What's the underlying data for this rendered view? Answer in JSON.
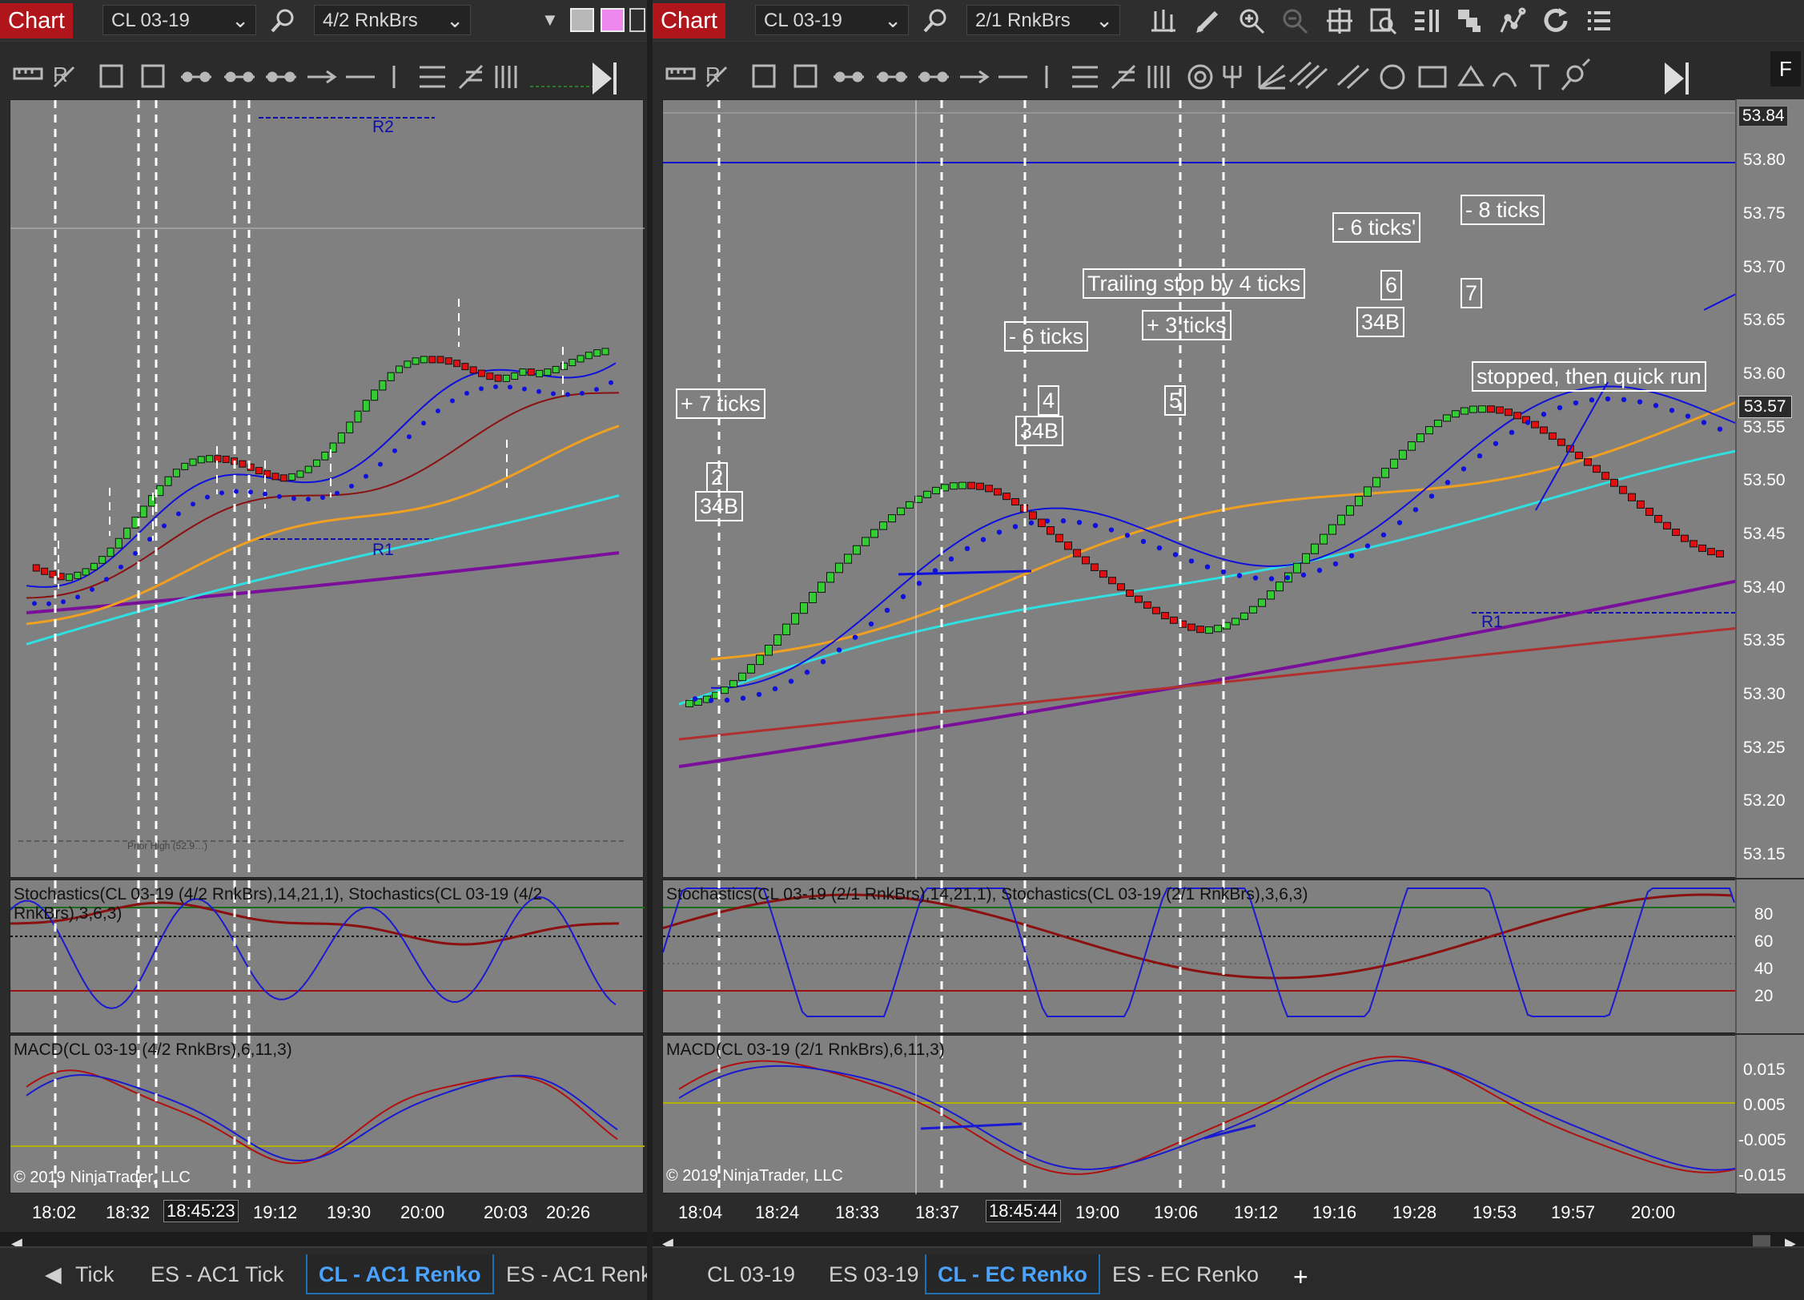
{
  "left": {
    "chart_tab": "Chart",
    "instrument": "CL 03-19",
    "period": "4/2 RnkBrs",
    "stochastics_label": "Stochastics(CL 03-19 (4/2 RnkBrs),14,21,1), Stochastics(CL 03-19 (4/2 RnkBrs),3,6,3)",
    "macd_label": "MACD(CL 03-19 (4/2 RnkBrs),6,11,3)",
    "copyright": "© 2019 NinjaTrader, LLC",
    "r2_label": "R2",
    "r1_label": "R1",
    "prior_high_label": "Prior High (52.9…)",
    "time_labels": [
      "18:02",
      "18:32",
      "18:45:23",
      "19:12",
      "19:30",
      "20:00",
      "20:03",
      "20:26"
    ],
    "tabs": [
      "Tick",
      "ES - AC1 Tick",
      "CL - AC1 Renko",
      "ES - AC1 Renk"
    ],
    "active_tab": "CL - AC1 Renko"
  },
  "right": {
    "chart_tab": "Chart",
    "instrument": "CL 03-19",
    "period": "2/1 RnkBrs",
    "stochastics_label": "Stochastics(CL 03-19 (2/1 RnkBrs),14,21,1), Stochastics(CL 03-19 (2/1 RnkBrs),3,6,3)",
    "macd_label": "MACD(CL 03-19 (2/1 RnkBrs),6,11,3)",
    "copyright": "© 2019 NinjaTrader, LLC",
    "r1_label": "R1",
    "f_button": "F",
    "price_labels": [
      "53.84",
      "53.80",
      "53.75",
      "53.70",
      "53.65",
      "53.60",
      "53.57",
      "53.55",
      "53.50",
      "53.45",
      "53.40",
      "53.35",
      "53.30",
      "53.25",
      "53.20",
      "53.15"
    ],
    "current_price": "53.57",
    "stoch_levels": [
      "80",
      "60",
      "40",
      "20"
    ],
    "macd_levels": [
      "0.015",
      "0.005",
      "-0.005",
      "-0.015"
    ],
    "time_labels": [
      "18:04",
      "18:24",
      "18:33",
      "18:37",
      "18:45:44",
      "19:00",
      "19:06",
      "19:12",
      "19:16",
      "19:28",
      "19:53",
      "19:57",
      "20:00"
    ],
    "annotations": {
      "plus7": "+ 7 ticks",
      "n2": "2",
      "b34_1": "34B",
      "minus6a": "- 6 ticks",
      "n4": "4",
      "b34_2": "34B",
      "trailing": "Trailing stop by 4 ticks",
      "plus3": "+ 3 ticks",
      "n5": "5",
      "minus6b": "- 6 ticks'",
      "n6": "6",
      "b34_3": "34B",
      "minus8": "- 8 ticks",
      "n7": "7",
      "stopped": "stopped, then quick run"
    },
    "tabs": [
      "CL 03-19",
      "ES 03-19",
      "CL - EC Renko",
      "ES - EC Renko",
      "+"
    ],
    "active_tab": "CL - EC Renko"
  },
  "colors": {
    "chart_bg": "#808080",
    "bull_candle": "#33cc33",
    "bear_candle": "#e01010",
    "ema_blue": "#1010dd",
    "ema_orange": "#f0a020",
    "ema_darkred": "#8b1010",
    "ema_cyan": "#30e0e0",
    "ema_purple": "#7a0f9a",
    "accent_tab": "#4aa3ff",
    "chart_tab_red": "#b1151c"
  }
}
